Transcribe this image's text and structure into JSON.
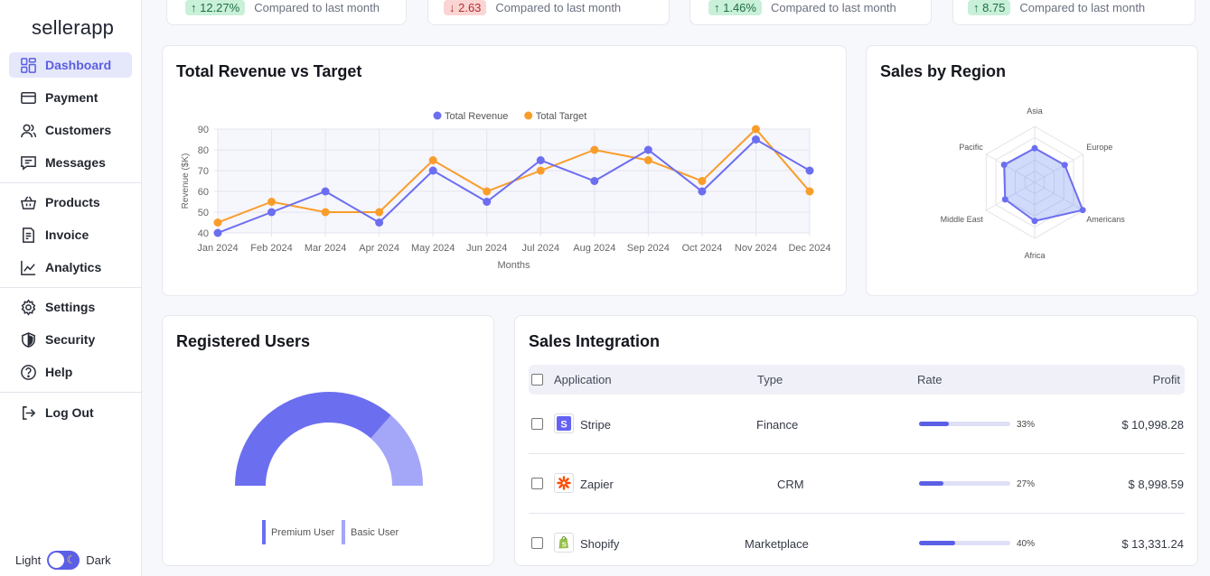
{
  "app": {
    "name": "sellerapp"
  },
  "sidebar": {
    "items": [
      {
        "label": "Dashboard",
        "icon": "dashboard-icon",
        "active": true
      },
      {
        "label": "Payment",
        "icon": "credit-card-icon"
      },
      {
        "label": "Customers",
        "icon": "users-icon"
      },
      {
        "label": "Messages",
        "icon": "message-icon"
      },
      {
        "label": "Products",
        "icon": "basket-icon"
      },
      {
        "label": "Invoice",
        "icon": "invoice-icon"
      },
      {
        "label": "Analytics",
        "icon": "analytics-icon"
      },
      {
        "label": "Settings",
        "icon": "gear-icon"
      },
      {
        "label": "Security",
        "icon": "shield-icon"
      },
      {
        "label": "Help",
        "icon": "help-icon"
      },
      {
        "label": "Log Out",
        "icon": "logout-icon"
      }
    ],
    "theme": {
      "light_label": "Light",
      "dark_label": "Dark",
      "is_dark": true
    }
  },
  "stats": [
    {
      "change": "↑ 12.27%",
      "direction": "up",
      "caption": "Compared to last month"
    },
    {
      "change": "↓ 2.63",
      "direction": "down",
      "caption": "Compared to last month"
    },
    {
      "change": "↑ 1.46%",
      "direction": "up",
      "caption": "Compared to last month"
    },
    {
      "change": "↑ 8.75",
      "direction": "up",
      "caption": "Compared to last month"
    }
  ],
  "revenue_panel": {
    "title": "Total Revenue vs Target"
  },
  "region_panel": {
    "title": "Sales by Region"
  },
  "users_panel": {
    "title": "Registered Users"
  },
  "integration_panel": {
    "title": "Sales Integration",
    "headers": {
      "application": "Application",
      "type": "Type",
      "rate": "Rate",
      "profit": "Profit"
    },
    "rows": [
      {
        "app": "Stripe",
        "icon": "stripe-icon",
        "type": "Finance",
        "rate_label": "33%",
        "rate": 0.33,
        "profit": "$ 10,998.28"
      },
      {
        "app": "Zapier",
        "icon": "zapier-icon",
        "type": "CRM",
        "rate_label": "27%",
        "rate": 0.27,
        "profit": "$ 8,998.59"
      },
      {
        "app": "Shopify",
        "icon": "shopify-icon",
        "type": "Marketplace",
        "rate_label": "40%",
        "rate": 0.4,
        "profit": "$ 13,331.24"
      }
    ]
  },
  "colors": {
    "accent": "#5b5fe6",
    "revenue": "#6c6ef0",
    "target": "#f99d2a",
    "basic_user": "#a4a6f7"
  },
  "chart_data": [
    {
      "type": "line",
      "title": "Total Revenue vs Target",
      "xlabel": "Months",
      "ylabel": "Revenue ($K)",
      "categories": [
        "Jan 2024",
        "Feb 2024",
        "Mar 2024",
        "Apr 2024",
        "May 2024",
        "Jun 2024",
        "Jul 2024",
        "Aug 2024",
        "Sep 2024",
        "Oct 2024",
        "Nov 2024",
        "Dec 2024"
      ],
      "ylim": [
        40,
        90
      ],
      "yticks": [
        40,
        50,
        60,
        70,
        80,
        90
      ],
      "legend_position": "top",
      "series": [
        {
          "name": "Total Revenue",
          "color": "#6c6ef0",
          "values": [
            40,
            50,
            60,
            45,
            70,
            55,
            75,
            65,
            80,
            60,
            85,
            70
          ]
        },
        {
          "name": "Total Target",
          "color": "#f99d2a",
          "values": [
            45,
            55,
            50,
            50,
            75,
            60,
            70,
            80,
            75,
            65,
            90,
            60
          ]
        }
      ]
    },
    {
      "type": "radar",
      "title": "Sales by Region",
      "categories": [
        "Asia",
        "Europe",
        "Americans",
        "Africa",
        "Middle East",
        "Pacific"
      ],
      "values": [
        0.61,
        0.62,
        0.99,
        0.69,
        0.61,
        0.63
      ],
      "rmax": 1
    },
    {
      "type": "pie",
      "title": "Registered Users",
      "style": "half-doughnut",
      "legend_position": "bottom",
      "series": [
        {
          "name": "Premium User",
          "color": "#6c6ef0",
          "value": 0.73
        },
        {
          "name": "Basic User",
          "color": "#a4a6f7",
          "value": 0.27
        }
      ]
    }
  ]
}
